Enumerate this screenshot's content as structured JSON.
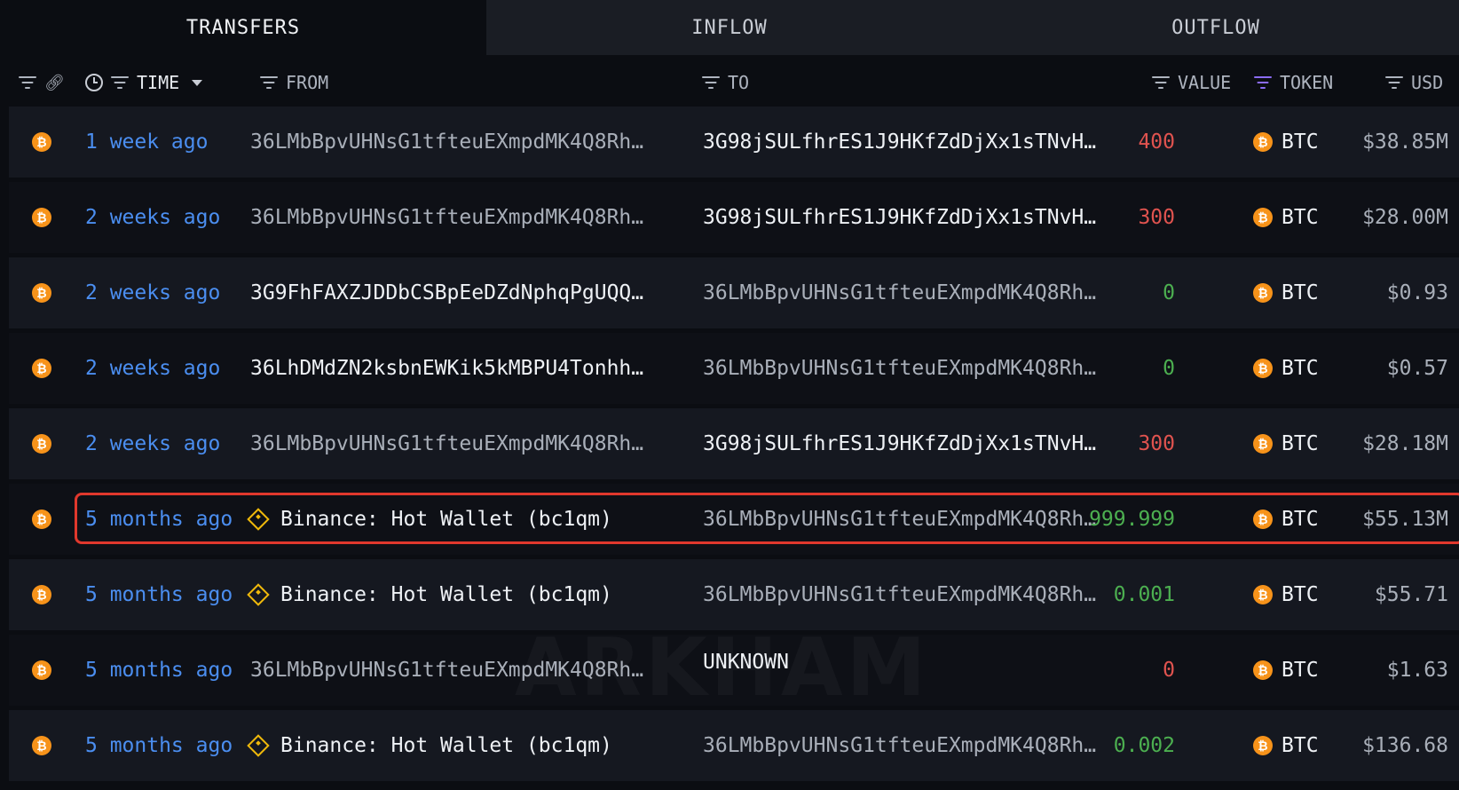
{
  "tabs": [
    {
      "label": "TRANSFERS",
      "active": true
    },
    {
      "label": "INFLOW",
      "active": false
    },
    {
      "label": "OUTFLOW",
      "active": false
    }
  ],
  "columns": {
    "time": "TIME",
    "from": "FROM",
    "to": "TO",
    "value": "VALUE",
    "token": "TOKEN",
    "usd": "USD"
  },
  "watermark": "ARKHAM",
  "rows": [
    {
      "time": "1 week ago",
      "from": "36LMbBpvUHNsG1tfteuEXmpdMK4Q8Rh…",
      "from_style": "dim",
      "to": "3G98jSULfhrES1J9HKfZdDjXx1sTNvH…",
      "to_style": "bright",
      "value": "400",
      "value_color": "red",
      "token": "BTC",
      "usd": "$38.85M"
    },
    {
      "time": "2 weeks ago",
      "from": "36LMbBpvUHNsG1tfteuEXmpdMK4Q8Rh…",
      "from_style": "dim",
      "to": "3G98jSULfhrES1J9HKfZdDjXx1sTNvH…",
      "to_style": "bright",
      "value": "300",
      "value_color": "red",
      "token": "BTC",
      "usd": "$28.00M"
    },
    {
      "time": "2 weeks ago",
      "from": "3G9FhFAXZJDDbCSBpEeDZdNphqPgUQQ…",
      "from_style": "bright",
      "to": "36LMbBpvUHNsG1tfteuEXmpdMK4Q8Rh…",
      "to_style": "dim",
      "value": "0",
      "value_color": "green",
      "token": "BTC",
      "usd": "$0.93"
    },
    {
      "time": "2 weeks ago",
      "from": "36LhDMdZN2ksbnEWKik5kMBPU4Tonhh…",
      "from_style": "bright",
      "to": "36LMbBpvUHNsG1tfteuEXmpdMK4Q8Rh…",
      "to_style": "dim",
      "value": "0",
      "value_color": "green",
      "token": "BTC",
      "usd": "$0.57"
    },
    {
      "time": "2 weeks ago",
      "from": "36LMbBpvUHNsG1tfteuEXmpdMK4Q8Rh…",
      "from_style": "dim",
      "to": "3G98jSULfhrES1J9HKfZdDjXx1sTNvH…",
      "to_style": "bright",
      "value": "300",
      "value_color": "red",
      "token": "BTC",
      "usd": "$28.18M"
    },
    {
      "time": "5 months ago",
      "from": "Binance: Hot Wallet (bc1qm)",
      "from_style": "entity",
      "to": "36LMbBpvUHNsG1tfteuEXmpdMK4Q8Rh…",
      "to_style": "dim",
      "value": "999.999",
      "value_color": "green",
      "token": "BTC",
      "usd": "$55.13M"
    },
    {
      "time": "5 months ago",
      "from": "Binance: Hot Wallet (bc1qm)",
      "from_style": "entity",
      "to": "36LMbBpvUHNsG1tfteuEXmpdMK4Q8Rh…",
      "to_style": "dim",
      "value": "0.001",
      "value_color": "green",
      "token": "BTC",
      "usd": "$55.71"
    },
    {
      "time": "5 months ago",
      "from": "36LMbBpvUHNsG1tfteuEXmpdMK4Q8Rh…",
      "from_style": "dim",
      "to": "UNKNOWN",
      "to_style": "unknown",
      "value": "0",
      "value_color": "red",
      "token": "BTC",
      "usd": "$1.63"
    },
    {
      "time": "5 months ago",
      "from": "Binance: Hot Wallet (bc1qm)",
      "from_style": "entity",
      "to": "36LMbBpvUHNsG1tfteuEXmpdMK4Q8Rh…",
      "to_style": "dim",
      "value": "0.002",
      "value_color": "green",
      "token": "BTC",
      "usd": "$136.68"
    }
  ],
  "highlighted_row": 5
}
